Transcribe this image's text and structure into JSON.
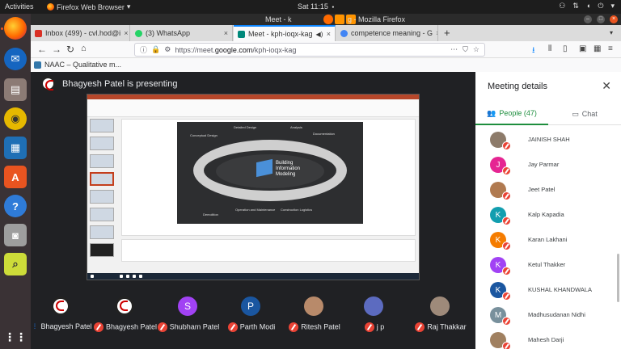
{
  "topbar": {
    "activities": "Activities",
    "app_name": "Firefox Web Browser",
    "app_caret": "▾",
    "clock": "Sat 11:15",
    "clock_dot": "●"
  },
  "browser": {
    "window_title": "Meet - k",
    "window_title_rest": "g - Mozilla Firefox",
    "tabs": [
      {
        "label": "Inbox (499) - cvl.hod@i",
        "color": "#d93025"
      },
      {
        "label": "(3) WhatsApp",
        "color": "#25d366"
      },
      {
        "label": "Meet - kph-ioqx-kag",
        "color": "#00897b"
      },
      {
        "label": "competence meaning - G",
        "color": "#4285f4"
      }
    ],
    "new_tab": "+",
    "url_prefix": "https://meet.",
    "url_domain": "google.com",
    "url_path": "/kph-ioqx-kag",
    "bookmark": "NAAC – Qualitative m..."
  },
  "meet": {
    "presenter_text": "Bhagyesh Patel is presenting",
    "slide_labels": {
      "detailed_design": "Detailed Design",
      "analysis": "Analysis",
      "conceptual_design": "Conceptual Design",
      "documentation": "Documentation",
      "bim": "Building\nInformation\nModeling",
      "demolition": "Demolition",
      "operation": "Operation and Maintenance",
      "construction": "Construction Logistics"
    },
    "tiles": [
      {
        "name": "Bhagyesh Patel",
        "initial": "",
        "color": "#ffffff",
        "mic": "on"
      },
      {
        "name": "Bhagyesh Patel",
        "initial": "",
        "color": "#ffffff",
        "mic": "off"
      },
      {
        "name": "Shubham Patel",
        "initial": "S",
        "color": "#a142f4",
        "mic": "off"
      },
      {
        "name": "Parth Modi",
        "initial": "P",
        "color": "#1a56a0",
        "mic": "off"
      },
      {
        "name": "Ritesh Patel",
        "initial": "",
        "color": "#b88a6a",
        "mic": "off"
      },
      {
        "name": "j p",
        "initial": "",
        "color": "#5c6bc0",
        "mic": "off"
      },
      {
        "name": "Raj Thakkar",
        "initial": "",
        "color": "#9e8a7a",
        "mic": "off"
      }
    ]
  },
  "panel": {
    "title": "Meeting details",
    "tab_people": "People (47)",
    "tab_chat": "Chat",
    "people": [
      {
        "name": "JAINISH SHAH",
        "initial": "",
        "color": "#8d7b6a"
      },
      {
        "name": "Jay Parmar",
        "initial": "J",
        "color": "#e52592"
      },
      {
        "name": "Jeet Patel",
        "initial": "",
        "color": "#b07a50"
      },
      {
        "name": "Kalp Kapadia",
        "initial": "K",
        "color": "#129eaf"
      },
      {
        "name": "Karan Lakhani",
        "initial": "K",
        "color": "#f57c00"
      },
      {
        "name": "Ketul Thakker",
        "initial": "K",
        "color": "#a142f4"
      },
      {
        "name": "KUSHAL KHANDWALA",
        "initial": "K",
        "color": "#1a56a0"
      },
      {
        "name": "Madhusudanan Nidhi",
        "initial": "M",
        "color": "#78909c"
      },
      {
        "name": "Mahesh Darji",
        "initial": "",
        "color": "#a08060"
      }
    ]
  }
}
